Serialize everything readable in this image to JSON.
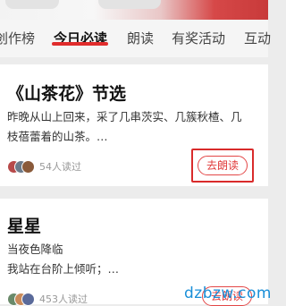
{
  "tabs": [
    {
      "label": "创作榜"
    },
    {
      "label": "今日必读"
    },
    {
      "label": "朗读"
    },
    {
      "label": "有奖活动"
    },
    {
      "label": "互动"
    }
  ],
  "cards": [
    {
      "title": "《山茶花》节选",
      "excerpt_line1": "昨晚从山上回来，采了几串茨实、几簇秋楂、几",
      "excerpt_line2": "枝蓓蕾着的山茶。…",
      "read_count": "54人读过",
      "button_label": "去朗读"
    },
    {
      "title": "星星",
      "excerpt_line1": "当夜色降临",
      "excerpt_line2": "我站在台阶上倾听；…",
      "read_count": "453人读过",
      "button_label": "去朗读"
    }
  ],
  "watermark": "dzbzw.com",
  "colors": {
    "accent": "#e02c2c",
    "highlight_box": "#d92b2b",
    "watermark": "#1a8fd8"
  }
}
